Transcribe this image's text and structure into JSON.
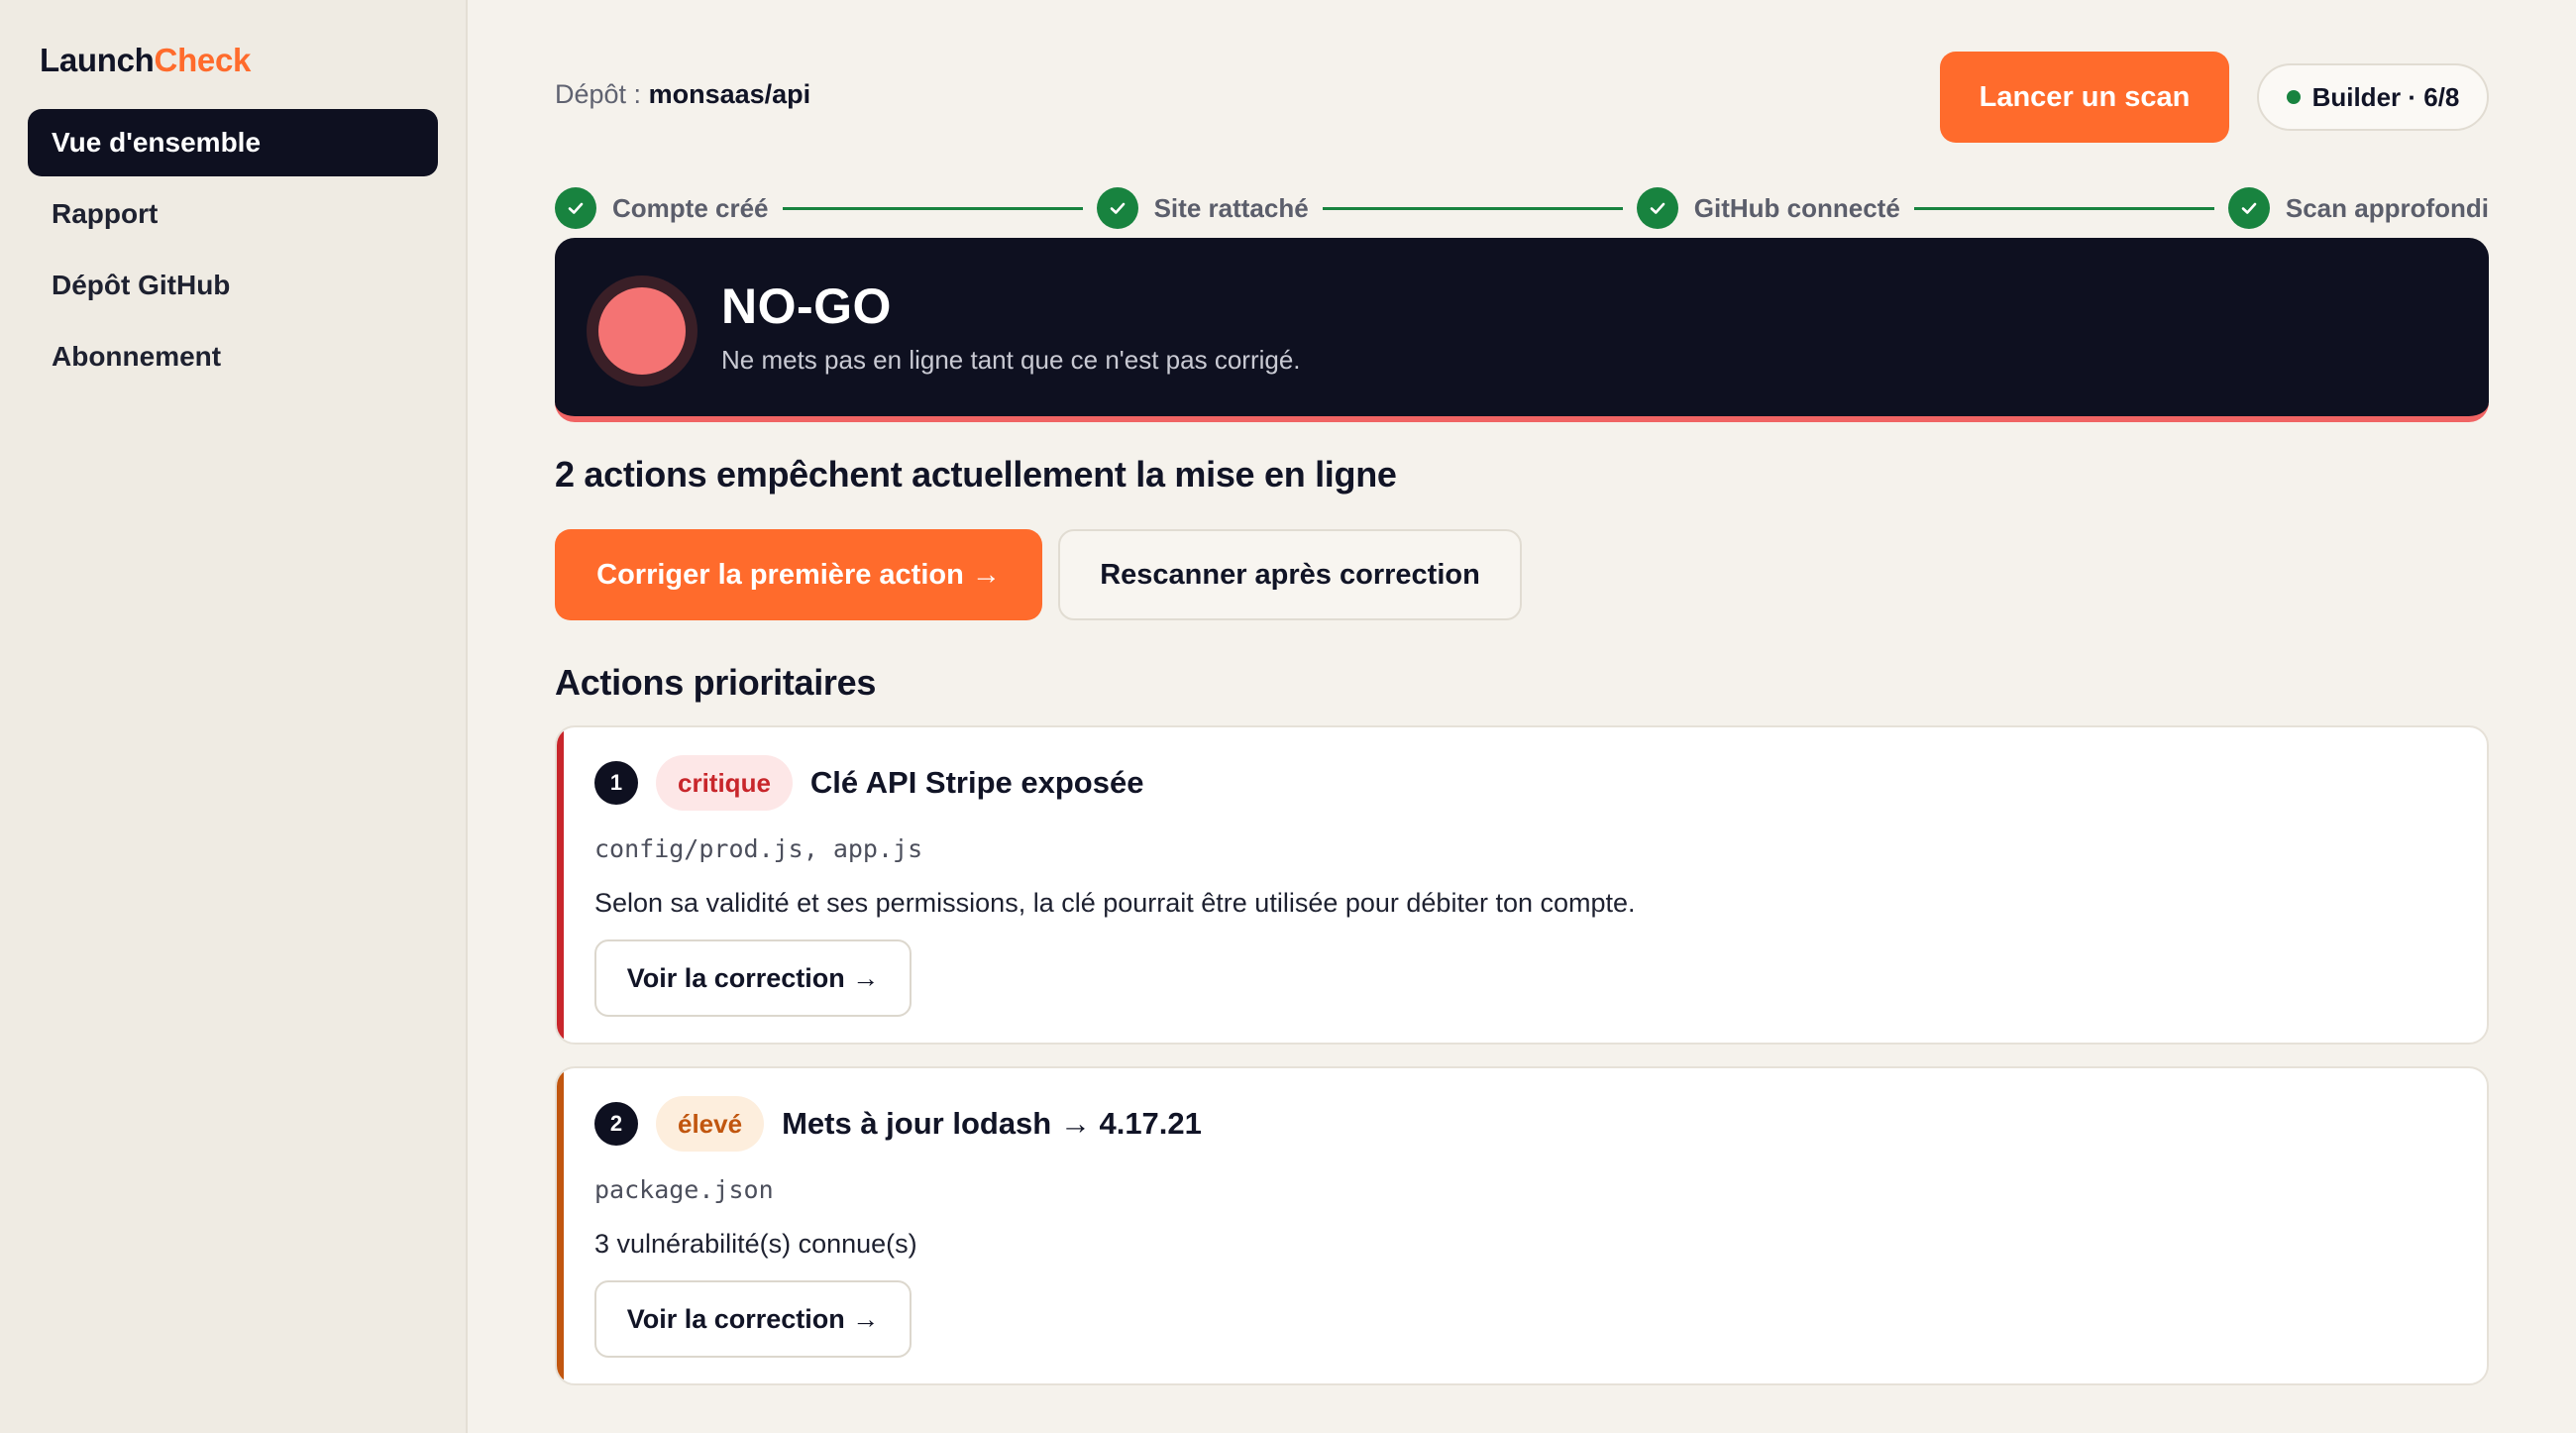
{
  "sidebar": {
    "brand_part1": "Launch",
    "brand_part2": "Check",
    "items": [
      {
        "label": "Vue d'ensemble",
        "active": true
      },
      {
        "label": "Rapport",
        "active": false
      },
      {
        "label": "Dépôt GitHub",
        "active": false
      },
      {
        "label": "Abonnement",
        "active": false
      }
    ]
  },
  "header": {
    "repo_label": "Dépôt :",
    "repo_name": "monsaas/api",
    "scan_button": "Lancer un scan",
    "plan_badge": "Builder · 6/8"
  },
  "stepper": {
    "steps": [
      {
        "label": "Compte créé",
        "icon": "check-icon"
      },
      {
        "label": "Site rattaché",
        "icon": "check-icon"
      },
      {
        "label": "GitHub connecté",
        "icon": "check-icon"
      },
      {
        "label": "Scan approfondi",
        "icon": "check-icon"
      }
    ]
  },
  "status": {
    "title": "NO-GO",
    "subtitle": "Ne mets pas en ligne tant que ce n'est pas corrigé."
  },
  "blocking": {
    "title": "2 actions empêchent actuellement la mise en ligne",
    "primary_button": "Corriger la première action →",
    "secondary_button": "Rescanner après correction"
  },
  "priority": {
    "title": "Actions prioritaires",
    "actions": [
      {
        "number": "1",
        "severity": "critique",
        "title": "Clé API Stripe exposée",
        "files": "config/prod.js, app.js",
        "description": "Selon sa validité et ses permissions, la clé pourrait être utilisée pour débiter ton compte.",
        "button": "Voir la correction →"
      },
      {
        "number": "2",
        "severity": "élevé",
        "title": "Mets à jour lodash → 4.17.21",
        "files": "package.json",
        "description": "3 vulnérabilité(s) connue(s)",
        "button": "Voir la correction →"
      }
    ]
  },
  "colors": {
    "accent": "#ff6b2c",
    "dark": "#0e1020",
    "success": "#18833f",
    "critical": "#c8262b",
    "critical_bg": "#fde7e7",
    "high": "#c1560f",
    "high_bg": "#fdeedd",
    "nogo": "#f47373"
  }
}
